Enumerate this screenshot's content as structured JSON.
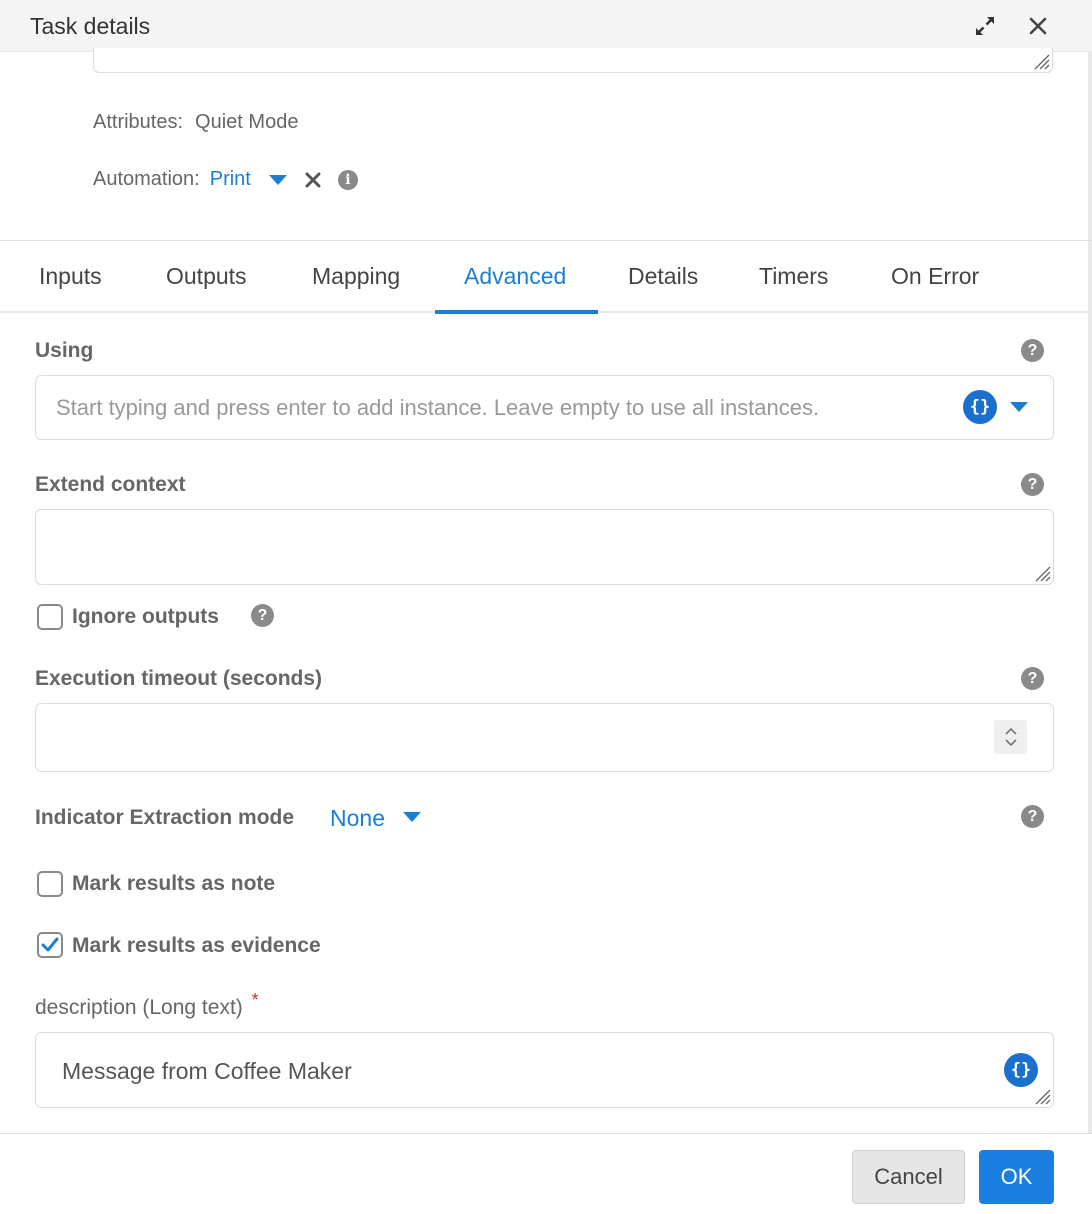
{
  "header": {
    "title": "Task details"
  },
  "attributes": {
    "label": "Attributes:",
    "value": "Quiet Mode"
  },
  "automation": {
    "label": "Automation:",
    "value": "Print"
  },
  "tabs": [
    {
      "label": "Inputs"
    },
    {
      "label": "Outputs"
    },
    {
      "label": "Mapping"
    },
    {
      "label": "Advanced"
    },
    {
      "label": "Details"
    },
    {
      "label": "Timers"
    },
    {
      "label": "On Error"
    }
  ],
  "active_tab": "Advanced",
  "using": {
    "label": "Using",
    "placeholder": "Start typing and press enter to add instance. Leave empty to use all instances."
  },
  "extend_context": {
    "label": "Extend context",
    "value": ""
  },
  "ignore_outputs": {
    "label": "Ignore outputs",
    "checked": false
  },
  "execution_timeout": {
    "label": "Execution timeout (seconds)",
    "value": ""
  },
  "indicator_extraction": {
    "label": "Indicator Extraction mode",
    "value": "None"
  },
  "mark_note": {
    "label": "Mark results as note",
    "checked": false
  },
  "mark_evidence": {
    "label": "Mark results as evidence",
    "checked": true
  },
  "description": {
    "label": "description (Long text)",
    "required_marker": "*",
    "value": "Message from Coffee Maker"
  },
  "footer": {
    "cancel_label": "Cancel",
    "ok_label": "OK"
  },
  "icons": {
    "help_glyph": "?",
    "curly_glyph": "{}",
    "info_glyph": "i"
  },
  "colors": {
    "accent": "#1a7fd1",
    "ok_button": "#1a7fe0",
    "required": "#c0392b"
  }
}
